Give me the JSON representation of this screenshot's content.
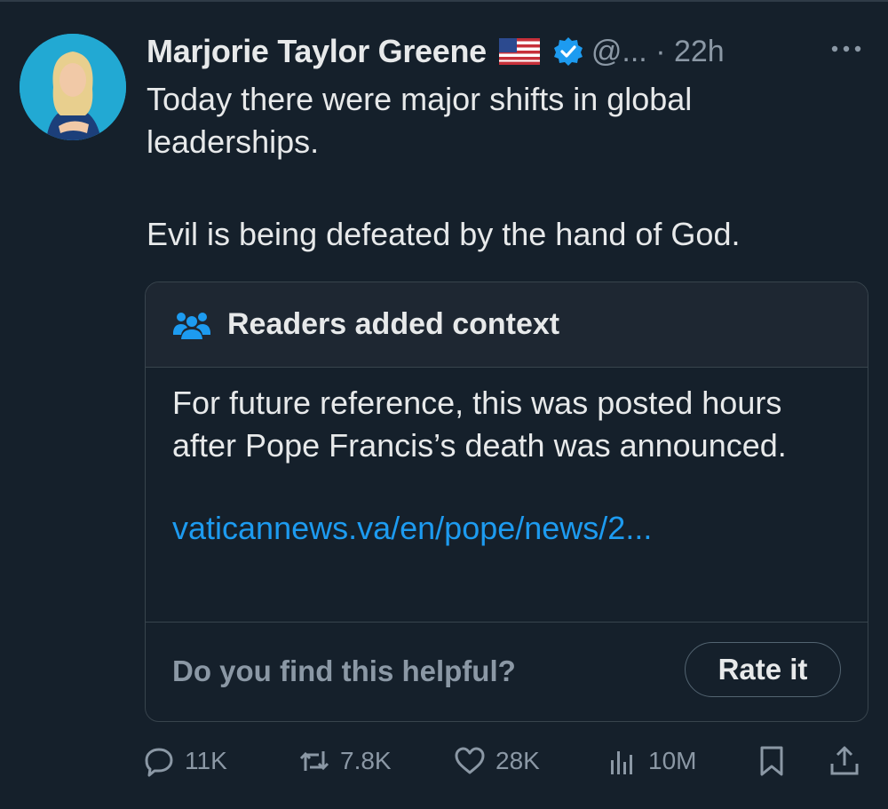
{
  "tweet": {
    "author_name": "Marjorie Taylor Greene",
    "handle_time": "@... · 22h",
    "text_line1": "Today there were major shifts in global leaderships.",
    "text_line2": "Evil is being defeated by the hand of God."
  },
  "community_note": {
    "title": "Readers added context",
    "body": "For future reference, this was posted hours after Pope Francis’s death was announced.",
    "link": "vaticannews.va/en/pope/news/2...",
    "helpful_question": "Do you find this helpful?",
    "rate_label": "Rate it"
  },
  "actions": {
    "replies": "11K",
    "reposts": "7.8K",
    "likes": "28K",
    "views": "10M"
  },
  "icons": {
    "flag": "us-flag-icon",
    "verified": "verified-badge-icon",
    "more": "more-icon",
    "people": "people-icon",
    "reply": "reply-icon",
    "repost": "repost-icon",
    "like": "heart-icon",
    "views": "views-icon",
    "bookmark": "bookmark-icon",
    "share": "share-icon"
  },
  "colors": {
    "background": "#15202b",
    "accent": "#1d9bf0",
    "secondary_text": "#8b98a5"
  }
}
